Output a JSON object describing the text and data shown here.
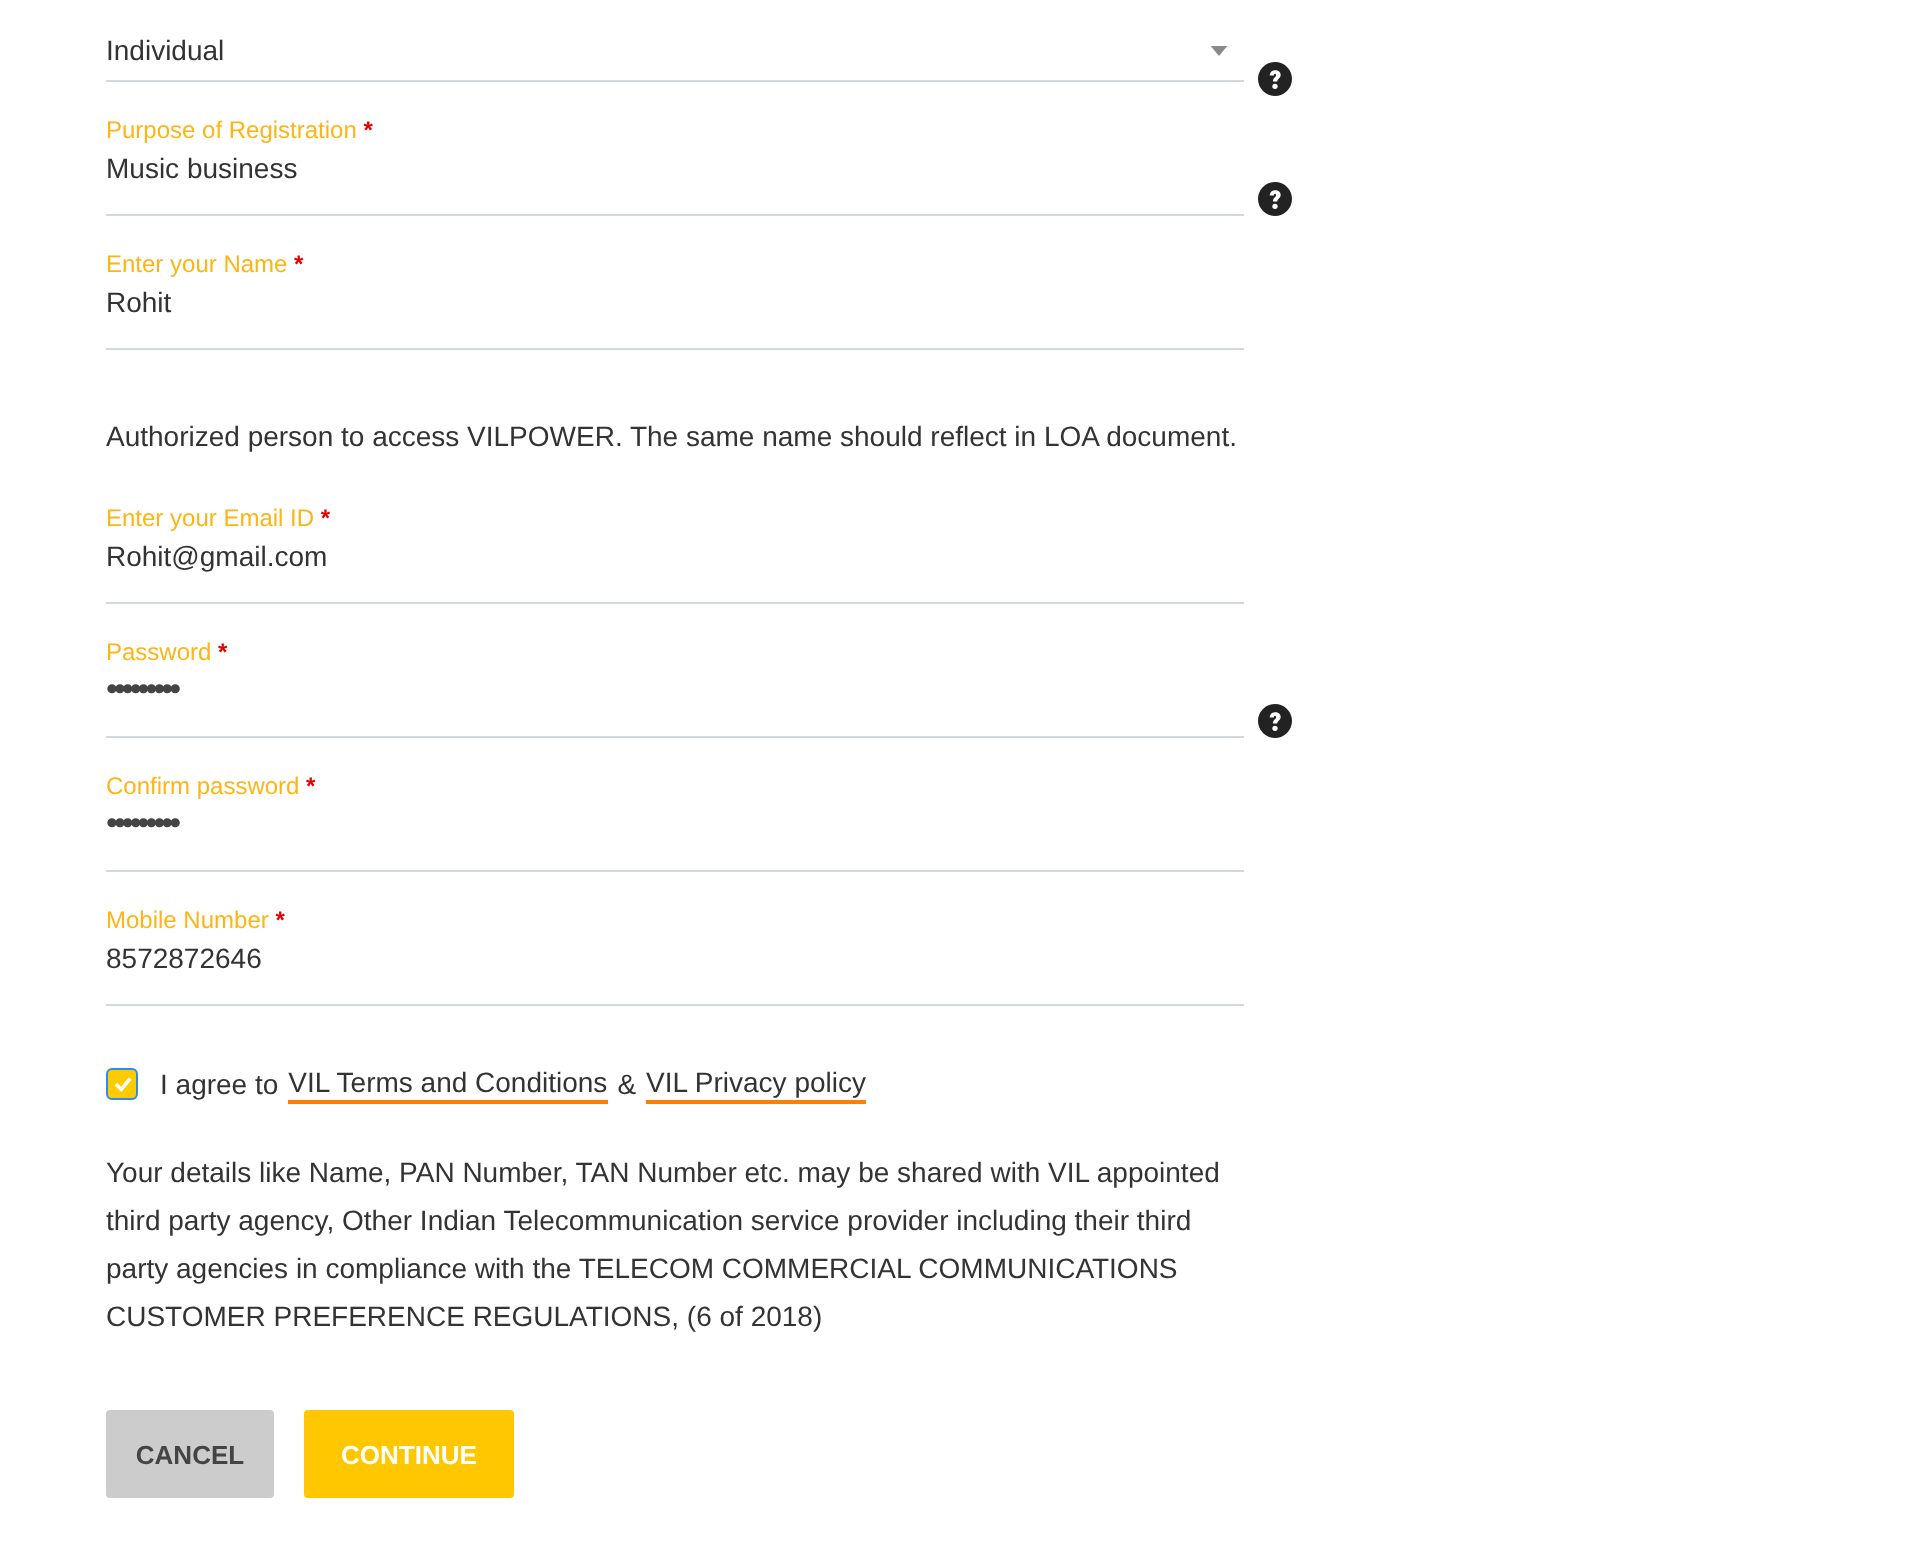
{
  "fields": [
    {
      "kind": "select",
      "value": "Individual",
      "help": true
    },
    {
      "kind": "text",
      "label": "Purpose of Registration",
      "required_mark": "*",
      "value": "Music business",
      "help": true
    },
    {
      "kind": "text",
      "label": "Enter your Name",
      "required_mark": "*",
      "value": "Rohit",
      "help": false
    },
    {
      "kind": "note",
      "text": "Authorized person to access VILPOWER. The same name should reflect in LOA document."
    },
    {
      "kind": "text",
      "label": "Enter your Email ID",
      "required_mark": "*",
      "value": "Rohit@gmail.com",
      "help": false
    },
    {
      "kind": "password",
      "label": "Password",
      "required_mark": "*",
      "value": "•••••••••",
      "help": true
    },
    {
      "kind": "password",
      "label": "Confirm password",
      "required_mark": "*",
      "value": "•••••••••",
      "help": false
    },
    {
      "kind": "text",
      "label": "Mobile Number",
      "required_mark": "*",
      "value": "8572872646",
      "help": false
    }
  ],
  "agreement": {
    "checked": true,
    "text": "I agree to",
    "terms_link": "VIL Terms and Conditions",
    "joiner": "&",
    "privacy_link": "VIL Privacy policy"
  },
  "disclaimer": "Your details like Name, PAN Number, TAN Number etc. may be shared with VIL appointed third party agency, Other Indian Telecommunication service provider including their third party agencies in compliance with the TELECOM COMMERCIAL COMMUNICATIONS CUSTOMER PREFERENCE REGULATIONS, (6 of 2018)",
  "buttons": [
    {
      "kind": "secondary",
      "label": "CANCEL"
    },
    {
      "kind": "primary",
      "label": "CONTINUE"
    }
  ]
}
